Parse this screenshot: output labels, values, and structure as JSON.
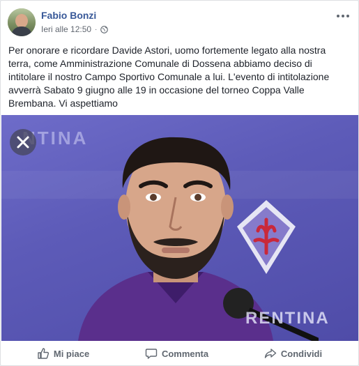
{
  "post": {
    "author": "Fabio Bonzi",
    "timestamp": "Ieri alle 12:50",
    "privacy_icon": "globe-icon",
    "text": "Per onorare e ricordare Davide Astori, uomo fortemente legato alla nostra terra, come Amministrazione Comunale di Dossena abbiamo deciso di intitolare il nostro Campo Sportivo Comunale a lui. L'evento di intitolazione avverrà Sabato 9 giugno alle 19 in occasione del torneo Coppa Valle Brembana. Vi aspettiamo"
  },
  "photo": {
    "banner_top": "NTINA",
    "banner_bottom": "RENTINA",
    "close_icon": "close-icon"
  },
  "actions": {
    "like_label": "Mi piace",
    "comment_label": "Commenta",
    "share_label": "Condividi"
  },
  "colors": {
    "author_link": "#385898",
    "photo_background": "#5d5bb8",
    "action_text": "#606770"
  }
}
